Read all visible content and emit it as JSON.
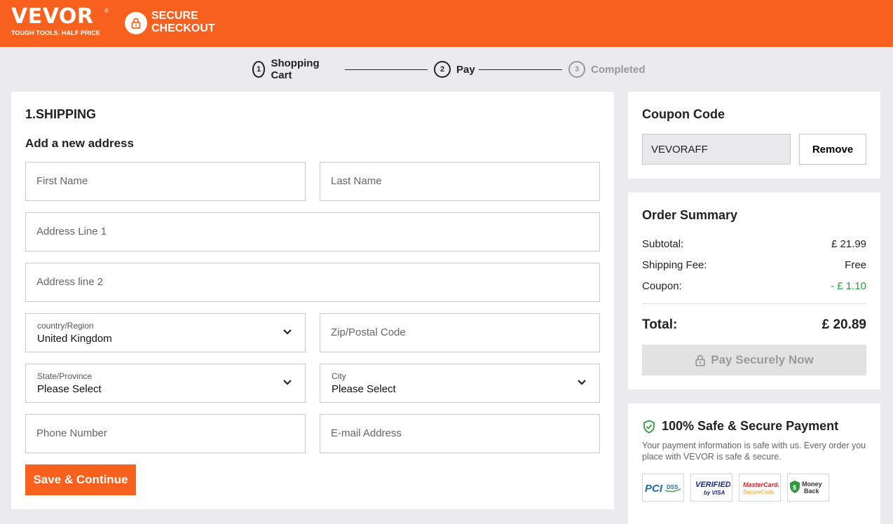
{
  "header": {
    "logo_text": "VEVOR",
    "logo_registered": "®",
    "logo_tagline": "TOUGH TOOLS. HALF PRICE",
    "secure_line1": "SECURE",
    "secure_line2": "CHECKOUT",
    "lock_icon": "lock-icon"
  },
  "steps": [
    {
      "number": "1",
      "label": "Shopping Cart",
      "state": "done"
    },
    {
      "number": "2",
      "label": "Pay",
      "state": "active"
    },
    {
      "number": "3",
      "label": "Completed",
      "state": "inactive"
    }
  ],
  "shipping": {
    "section_title": "1.SHIPPING",
    "subtitle": "Add a new address",
    "first_name_placeholder": "First Name",
    "last_name_placeholder": "Last Name",
    "address1_placeholder": "Address Line 1",
    "address2_placeholder": "Address line 2",
    "country_label": "country/Region",
    "country_value": "United Kingdom",
    "zip_placeholder": "Zip/Postal Code",
    "state_label": "State/Province",
    "state_value": "Please Select",
    "city_label": "City",
    "city_value": "Please Select",
    "phone_placeholder": "Phone Number",
    "email_placeholder": "E-mail Address",
    "save_button": "Save & Continue"
  },
  "coupon": {
    "title": "Coupon Code",
    "code": "VEVORAFF",
    "remove_button": "Remove"
  },
  "summary": {
    "title": "Order Summary",
    "subtotal_label": "Subtotal:",
    "subtotal_value": "£ 21.99",
    "shipping_label": "Shipping Fee:",
    "shipping_value": "Free",
    "coupon_label": "Coupon:",
    "coupon_value": "- £ 1.10",
    "total_label": "Total:",
    "total_value": "£ 20.89",
    "pay_button": "Pay Securely Now"
  },
  "safe": {
    "title": "100% Safe & Secure Payment",
    "description": "Your payment information is safe with us. Every order you place with VEVOR is safe & secure.",
    "badges": [
      "PCI DSS",
      "Verified by VISA",
      "MasterCard SecureCode",
      "Money Back"
    ]
  },
  "colors": {
    "brand": "#f7601d",
    "background": "#ebebed",
    "discount_green": "#2f9a3a",
    "disabled_gray": "#e2e2e2"
  }
}
